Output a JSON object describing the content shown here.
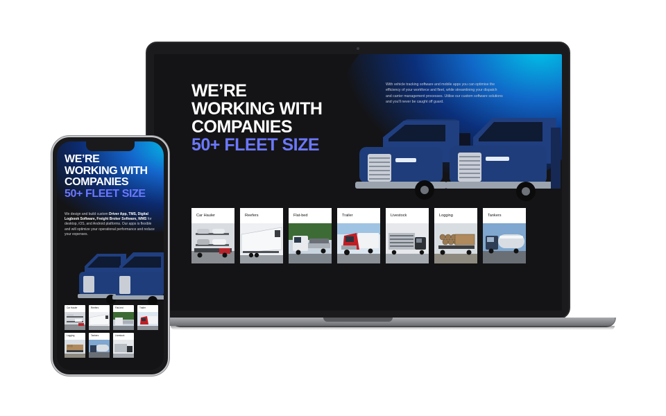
{
  "hero": {
    "line1": "WE’RE",
    "line2": "WORKING WITH",
    "line3": "COMPANIES",
    "accent": "50+ FLEET SIZE",
    "description": "With vehicle tracking software and mobile apps you can optimise the efficiency of your workforce and fleet, while streamlining your dispatch and carrier management processes. Utilise our custom software solutions and you'll never be caught off guard."
  },
  "categories": [
    {
      "label": "Car Hauler",
      "icon": "car-hauler"
    },
    {
      "label": "Reefers",
      "icon": "reefer-trailer"
    },
    {
      "label": "Flat-bed",
      "icon": "flatbed-truck"
    },
    {
      "label": "Trailer",
      "icon": "red-semi-truck"
    },
    {
      "label": "Livestock",
      "icon": "livestock-trailer"
    },
    {
      "label": "Logging",
      "icon": "logging-truck"
    },
    {
      "label": "Tankers",
      "icon": "tanker-truck"
    }
  ],
  "mobile": {
    "line1": "WE’RE",
    "line2": "WORKING WITH",
    "line3": "COMPANIES",
    "accent": "50+ FLEET SIZE",
    "desc_prefix": "We design and build custom ",
    "desc_bold": "Driver App, TMS, Digital Logbook Software, Freight Broker Software, WMS",
    "desc_suffix": " for desktop, iOS, and Android platforms. Our apps is flexible and will optimize your operational performance and reduce your expenses.",
    "categories": [
      {
        "label": "Car Hauler"
      },
      {
        "label": "Reefers"
      },
      {
        "label": "Flat-bed"
      },
      {
        "label": "Trailer"
      },
      {
        "label": "Logging"
      },
      {
        "label": "Tankers"
      },
      {
        "label": "Livestock"
      }
    ]
  },
  "colors": {
    "accent": "#6b78ff",
    "background": "#141416",
    "glow": "#00c4e8",
    "truck": "#1f3d7a"
  }
}
